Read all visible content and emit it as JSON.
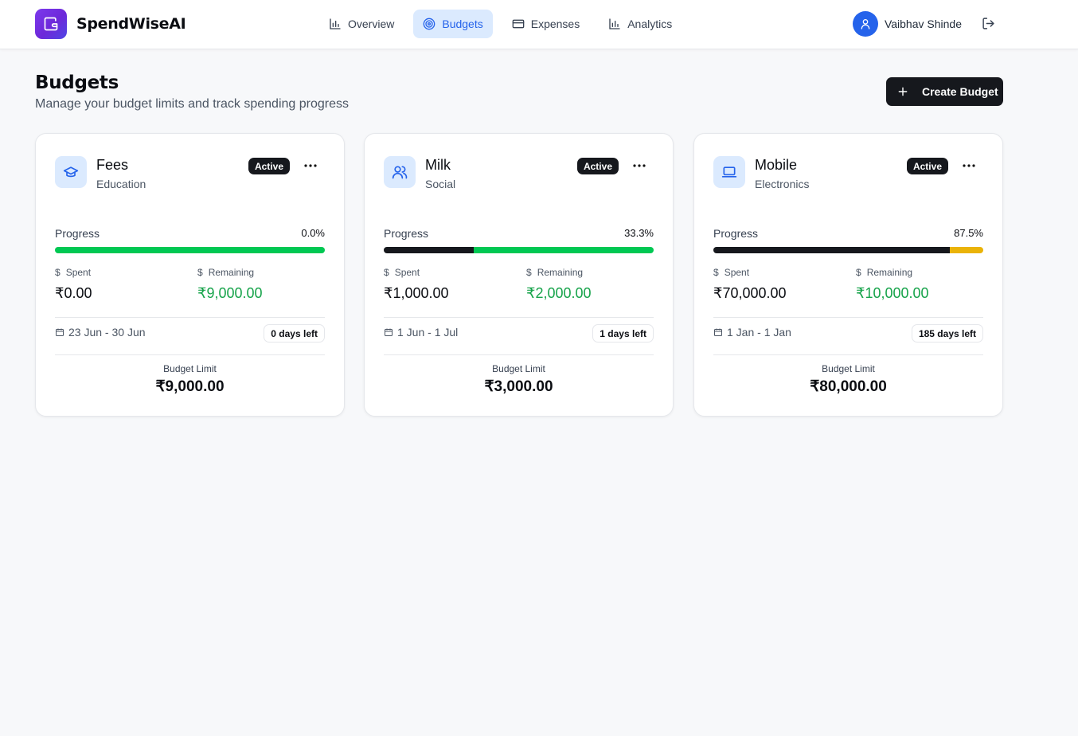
{
  "app": {
    "name": "SpendWiseAI"
  },
  "nav": [
    {
      "label": "Overview",
      "icon": "bar-chart-icon"
    },
    {
      "label": "Budgets",
      "icon": "target-icon",
      "active": true
    },
    {
      "label": "Expenses",
      "icon": "credit-card-icon"
    },
    {
      "label": "Analytics",
      "icon": "bar-chart-icon"
    }
  ],
  "user": {
    "name": "Vaibhav Shinde",
    "avatar_icon": "user-icon",
    "logout_icon": "logout-icon"
  },
  "header": {
    "title": "Budgets",
    "subtitle": "Manage your budget limits and track spending progress",
    "create_label": "Create Budget"
  },
  "labels": {
    "progress": "Progress",
    "spent": "Spent",
    "remaining": "Remaining",
    "budget_limit": "Budget Limit"
  },
  "colors": {
    "accent": "#2563eb",
    "remaining_green": "#16a34a",
    "bar_green": "#00c853",
    "bar_amber": "#eab308",
    "dark": "#16181d"
  },
  "budgets": [
    {
      "name": "Fees",
      "category": "Education",
      "icon": "graduation-cap-icon",
      "status": "Active",
      "progress_label": "0.0%",
      "progress": 0.0,
      "spent": "₹0.00",
      "remaining": "₹9,000.00",
      "dates": "23 Jun - 30 Jun",
      "days_left": "0 days left",
      "limit": "₹9,000.00",
      "bar_rest_color": "#00c853"
    },
    {
      "name": "Milk",
      "category": "Social",
      "icon": "users-icon",
      "status": "Active",
      "progress_label": "33.3%",
      "progress": 33.3,
      "spent": "₹1,000.00",
      "remaining": "₹2,000.00",
      "dates": "1 Jun - 1 Jul",
      "days_left": "1 days left",
      "limit": "₹3,000.00",
      "bar_rest_color": "#00c853"
    },
    {
      "name": "Mobile",
      "category": "Electronics",
      "icon": "laptop-icon",
      "status": "Active",
      "progress_label": "87.5%",
      "progress": 87.5,
      "spent": "₹70,000.00",
      "remaining": "₹10,000.00",
      "dates": "1 Jan - 1 Jan",
      "days_left": "185 days left",
      "limit": "₹80,000.00",
      "bar_rest_color": "#eab308"
    }
  ]
}
